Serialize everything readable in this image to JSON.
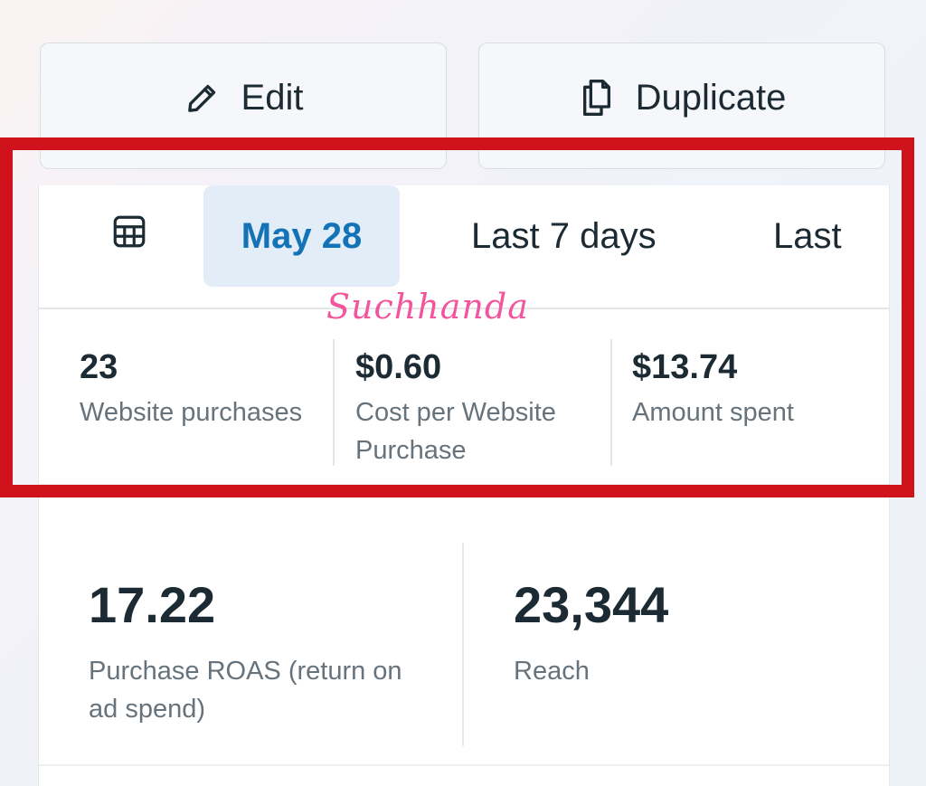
{
  "actions": {
    "edit_label": "Edit",
    "duplicate_label": "Duplicate"
  },
  "tabs": [
    {
      "label": "May 28",
      "selected": true
    },
    {
      "label": "Last 7 days",
      "selected": false
    },
    {
      "label": "Last",
      "selected": false
    }
  ],
  "watermark": "Suchhanda",
  "metrics": [
    {
      "value": "23",
      "label": "Website purchases"
    },
    {
      "value": "$0.60",
      "label": "Cost per Website Purchase"
    },
    {
      "value": "$13.74",
      "label": "Amount spent"
    }
  ],
  "big_metrics": [
    {
      "value": "17.22",
      "label": "Purchase ROAS (return on ad spend)"
    },
    {
      "value": "23,344",
      "label": "Reach"
    }
  ],
  "colors": {
    "accent_blue": "#1473b7",
    "selected_tab_bg": "#e2edf7",
    "highlight_red": "#d0121d",
    "watermark_pink": "#f2559c",
    "text_primary": "#1c2b33",
    "text_secondary": "#67737c"
  },
  "icons": {
    "edit": "pencil-icon",
    "duplicate": "copy-icon",
    "calendar": "calendar-grid-icon"
  }
}
